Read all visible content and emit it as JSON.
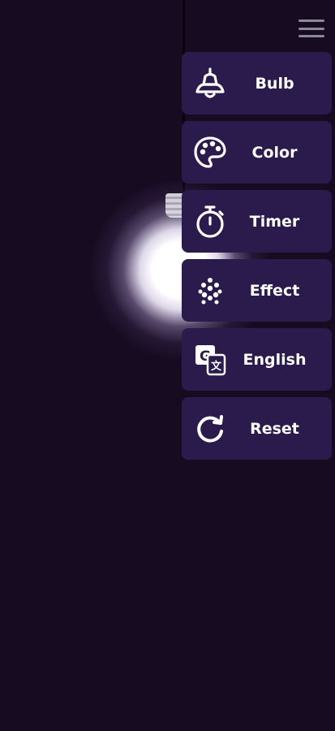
{
  "theme": {
    "background": "#170b22",
    "menu_item_background": "#2b1a4c",
    "text_color": "#ffffff",
    "menu_icon_color": "#8d8896"
  },
  "header": {
    "menu_icon": "hamburger-menu-icon"
  },
  "menu": {
    "items": [
      {
        "label": "Bulb",
        "icon": "bulb-icon"
      },
      {
        "label": "Color",
        "icon": "palette-icon"
      },
      {
        "label": "Timer",
        "icon": "stopwatch-icon"
      },
      {
        "label": "Effect",
        "icon": "effect-dots-icon"
      },
      {
        "label": "English",
        "icon": "translate-icon"
      },
      {
        "label": "Reset",
        "icon": "reset-icon"
      }
    ]
  }
}
